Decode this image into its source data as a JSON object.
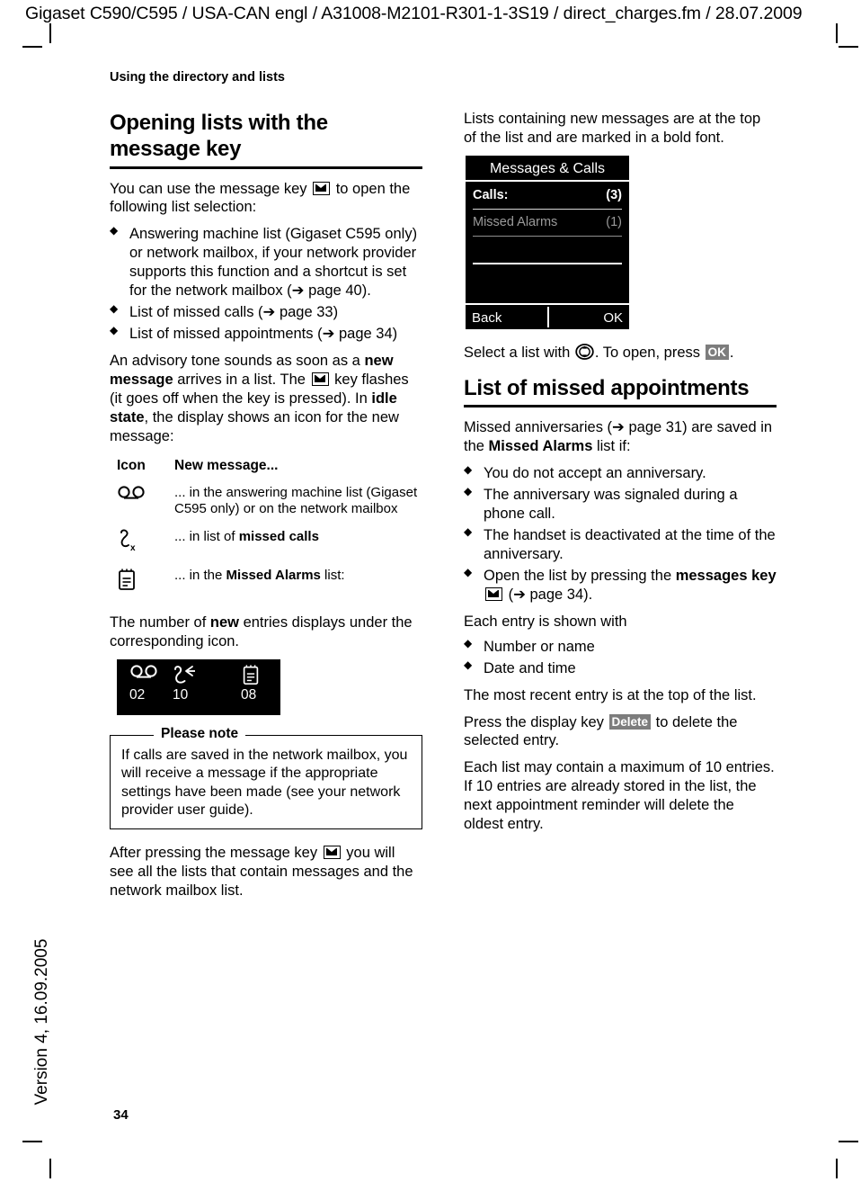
{
  "document": {
    "header": "Gigaset C590/C595 / USA-CAN engl / A31008-M2101-R301-1-3S19 / direct_charges.fm / 28.07.2009",
    "version_footer": "Version 4, 16.09.2005",
    "page_number": "34",
    "chapter": "Using the directory and lists"
  },
  "left": {
    "heading_line1": "Opening lists with the",
    "heading_line2": "message key",
    "intro_a": "You can use the message key ",
    "intro_b": " to open the following list selection:",
    "bullets": [
      "Answering machine list (Gigaset C595 only) or network mailbox, if your network provider supports this function and a shortcut is set for the network mailbox (➔ page 40).",
      "List of missed calls (➔ page 33)",
      "List of missed appointments (➔ page 34)"
    ],
    "advisory_1": "An advisory tone sounds as soon as a ",
    "advisory_bold_1": "new message",
    "advisory_2": " arrives in a list. The ",
    "advisory_3": " key flashes (it goes off when the key is pressed). In ",
    "advisory_bold_2": "idle state",
    "advisory_4": ", the display shows an icon for the new message:",
    "icon_table": {
      "header_icon": "Icon",
      "header_desc": "New message...",
      "rows": [
        {
          "icon": "answering-machine-tape-icon",
          "desc_plain": "... in the answering machine list (Gigaset C595 only) or on the network mailbox",
          "desc_bold": ""
        },
        {
          "icon": "missed-call-handset-icon",
          "desc_plain": "... in list of ",
          "desc_bold": "missed calls"
        },
        {
          "icon": "missed-alarms-clipboard-icon",
          "desc_plain": "... in the ",
          "desc_bold": "Missed Alarms",
          "desc_tail": " list:"
        }
      ]
    },
    "counts_para_1": "The number of ",
    "counts_para_bold": "new",
    "counts_para_2": " entries displays under the corresponding icon.",
    "counter_display": {
      "items": [
        {
          "icon": "answering-machine-tape-icon",
          "count": "02"
        },
        {
          "icon": "missed-call-handset-icon",
          "count": "10"
        },
        {
          "icon": "missed-alarms-clipboard-icon",
          "count": "08"
        }
      ]
    },
    "note": {
      "legend": "Please note",
      "text": "If calls are saved in the network mailbox, you will receive a message if the appropriate settings have been made (see your network provider user guide)."
    },
    "closing_1": "After pressing the message key ",
    "closing_2": " you will see all the lists that contain messages and the network mailbox list."
  },
  "right": {
    "intro": "Lists containing new messages are at the top of the list and are marked in a bold font.",
    "handset": {
      "title": "Messages & Calls",
      "rows": [
        {
          "label": "Calls:",
          "count": "(3)",
          "bold": true
        },
        {
          "label": "Missed Alarms",
          "count": "(1)",
          "bold": false
        }
      ],
      "softkey_left": "Back",
      "softkey_right": "OK"
    },
    "select_1": "Select a list with ",
    "select_2": ". To open, press ",
    "select_key": "OK",
    "select_3": ".",
    "heading": "List of missed appointments",
    "saved_1": "Missed anniversaries (➔ page 31) are saved in the ",
    "saved_bold": "Missed Alarms",
    "saved_2": " list if:",
    "bullets": [
      "You do not accept an anniversary.",
      "The anniversary was signaled during a phone call.",
      "The handset is deactivated at the time of the anniversary.",
      "Open the list by pressing the "
    ],
    "bullet4_bold": "messages key",
    "bullet4_tail": " (➔ page 34).",
    "each_entry": "Each entry is shown with",
    "entry_bullets": [
      "Number or name",
      "Date and time"
    ],
    "most_recent": "The most recent entry is at the  top of the list.",
    "press_1": "Press the display key ",
    "press_key": "Delete",
    "press_2": " to delete the selected entry.",
    "max_entries": "Each list may contain a maximum of 10 entries. If 10 entries are already stored in the list, the next appointment reminder will delete the oldest entry."
  },
  "colors": {
    "page_bg": "#ffffff",
    "text": "#000000",
    "display_bg": "#000000",
    "display_text": "#ffffff",
    "display_dim_text": "#9a9a9a",
    "softkey_bg": "#7d7d7d"
  }
}
